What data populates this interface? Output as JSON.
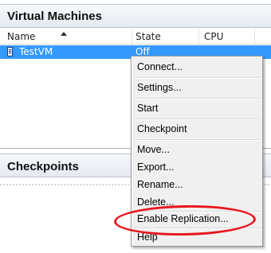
{
  "vm_panel": {
    "title": "Virtual Machines",
    "columns": [
      "Name",
      "State",
      "CPU Usage"
    ],
    "rows": [
      {
        "name": "TestVM",
        "state": "Off"
      }
    ]
  },
  "checkpoints_panel": {
    "title": "Checkpoints"
  },
  "context_menu": {
    "items": [
      "Connect...",
      "Settings...",
      "Start",
      "Checkpoint",
      "Move...",
      "Export...",
      "Rename...",
      "Delete...",
      "Enable Replication...",
      "Help"
    ]
  },
  "annotation": {
    "highlight_color": "#e8151b",
    "highlighted_item": "Enable Replication..."
  },
  "colors": {
    "selection": "#3399ff",
    "menu_background": "#f0f0f0"
  }
}
